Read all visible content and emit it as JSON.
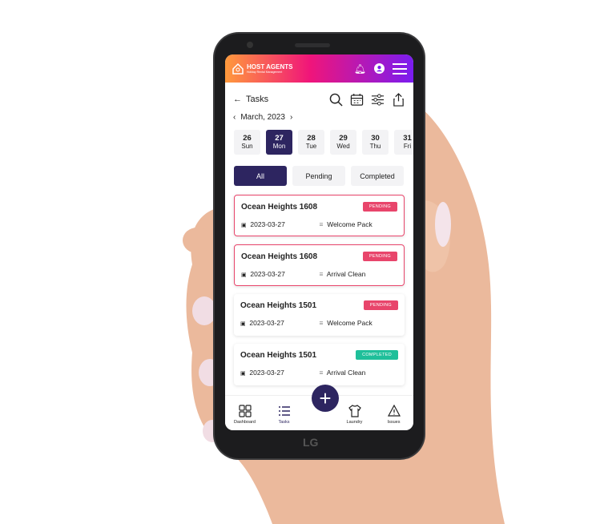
{
  "header": {
    "brand": "HOST AGENTS",
    "tagline": "Holiday Rental Management"
  },
  "toolbar": {
    "back_label": "Tasks"
  },
  "month": "March, 2023",
  "days": [
    {
      "num": "26",
      "dow": "Sun"
    },
    {
      "num": "27",
      "dow": "Mon",
      "selected": true
    },
    {
      "num": "28",
      "dow": "Tue"
    },
    {
      "num": "29",
      "dow": "Wed"
    },
    {
      "num": "30",
      "dow": "Thu"
    },
    {
      "num": "31",
      "dow": "Fri"
    }
  ],
  "filters": [
    "All",
    "Pending",
    "Completed"
  ],
  "tasks": [
    {
      "title": "Ocean Heights 1608",
      "status": "PENDING",
      "date": "2023-03-27",
      "type": "Welcome Pack",
      "highlight": true
    },
    {
      "title": "Ocean Heights 1608",
      "status": "PENDING",
      "date": "2023-03-27",
      "type": "Arrival Clean",
      "highlight": true
    },
    {
      "title": "Ocean Heights 1501",
      "status": "PENDING",
      "date": "2023-03-27",
      "type": "Welcome Pack",
      "highlight": false
    },
    {
      "title": "Ocean Heights 1501",
      "status": "COMPLETED",
      "date": "2023-03-27",
      "type": "Arrival Clean",
      "highlight": false
    }
  ],
  "nav": {
    "dashboard": "Dashboard",
    "tasks": "Tasks",
    "laundry": "Laundry",
    "issues": "Issues"
  },
  "device_brand": "LG",
  "colors": {
    "primary": "#2d2560",
    "pending": "#e8456b",
    "completed": "#1fbf9a"
  }
}
